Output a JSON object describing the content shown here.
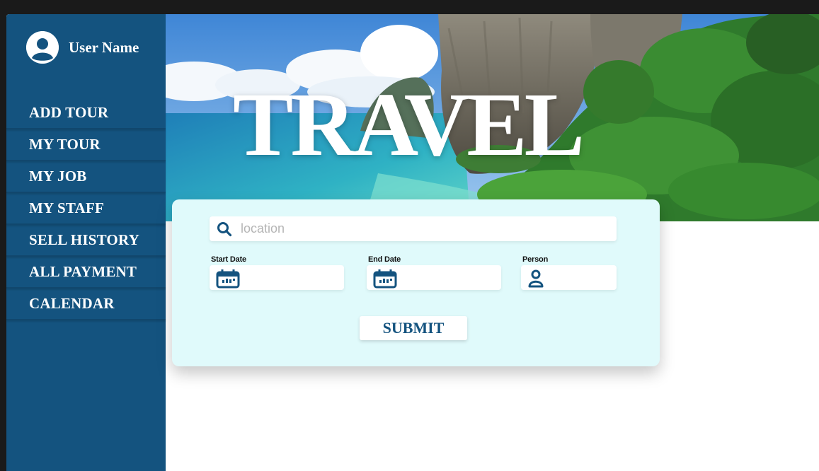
{
  "user": {
    "name": "User Name"
  },
  "sidebar": {
    "items": [
      {
        "label": "ADD TOUR"
      },
      {
        "label": "MY TOUR"
      },
      {
        "label": "MY JOB"
      },
      {
        "label": "MY STAFF"
      },
      {
        "label": "SELL HISTORY"
      },
      {
        "label": "ALL PAYMENT"
      },
      {
        "label": "CALENDAR"
      }
    ]
  },
  "hero": {
    "title": "TRAVEL"
  },
  "search": {
    "placeholder": "location",
    "value": ""
  },
  "fields": {
    "start_date": {
      "label": "Start Date",
      "icon": "calendar-icon"
    },
    "end_date": {
      "label": "End Date",
      "icon": "calendar-icon"
    },
    "person": {
      "label": "Person",
      "icon": "person-icon"
    }
  },
  "submit": {
    "label": "SUBMIT"
  },
  "colors": {
    "sidebar": "#14537f",
    "card": "#e0fafb",
    "accent": "#14537f"
  }
}
